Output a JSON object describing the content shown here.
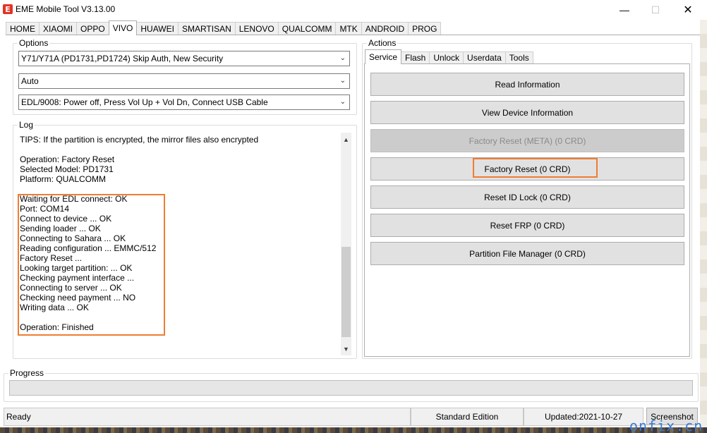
{
  "window": {
    "title": "EME Mobile Tool V3.13.00",
    "logo_letter": "E",
    "minimize": "—",
    "maximize": "☐",
    "close": "✕"
  },
  "main_tabs": [
    "HOME",
    "XIAOMI",
    "OPPO",
    "VIVO",
    "HUAWEI",
    "SMARTISAN",
    "LENOVO",
    "QUALCOMM",
    "MTK",
    "ANDROID",
    "PROG"
  ],
  "active_main_tab": "VIVO",
  "options": {
    "title": "Options",
    "model_select": "Y71/Y71A (PD1731,PD1724) Skip Auth, New Security",
    "mode_select": "Auto",
    "connection_select": "EDL/9008: Power off, Press Vol Up + Vol Dn, Connect USB Cable"
  },
  "log": {
    "title": "Log",
    "lines": [
      "TIPS: If the partition is encrypted, the mirror files also encrypted",
      "",
      "Operation: Factory Reset",
      "Selected Model: PD1731",
      "Platform: QUALCOMM",
      "",
      "Waiting for EDL connect: OK",
      "Port: COM14",
      "Connect to device ... OK",
      "Sending loader ... OK",
      "Connecting to Sahara ... OK",
      "Reading configuration ... EMMC/512",
      "Factory Reset ...",
      "Looking target partition: ... OK",
      "Checking payment interface ...",
      "Connecting to server ... OK",
      "Checking need payment ... NO",
      "Writing data ... OK",
      "",
      "Operation: Finished"
    ]
  },
  "actions": {
    "title": "Actions",
    "tabs": [
      "Service",
      "Flash",
      "Unlock",
      "Userdata",
      "Tools"
    ],
    "active_tab": "Service",
    "buttons": [
      {
        "label": "Read Information",
        "enabled": true
      },
      {
        "label": "View Device Information",
        "enabled": true
      },
      {
        "label": "Factory Reset (META) (0 CRD)",
        "enabled": false
      },
      {
        "label": "Factory Reset (0 CRD)",
        "enabled": true
      },
      {
        "label": "Reset ID Lock (0 CRD)",
        "enabled": true
      },
      {
        "label": "Reset FRP (0 CRD)",
        "enabled": true
      },
      {
        "label": "Partition File Manager (0 CRD)",
        "enabled": true
      }
    ]
  },
  "progress": {
    "title": "Progress",
    "value": 0
  },
  "status": {
    "state": "Ready",
    "edition": "Standard Edition",
    "updated": "Updated:2021-10-27",
    "screenshot_label": "Screenshot"
  },
  "watermark": "onfix.cn",
  "colors": {
    "highlight": "#ee7d31",
    "logo": "#e53323",
    "watermark": "#3a7bd5"
  }
}
